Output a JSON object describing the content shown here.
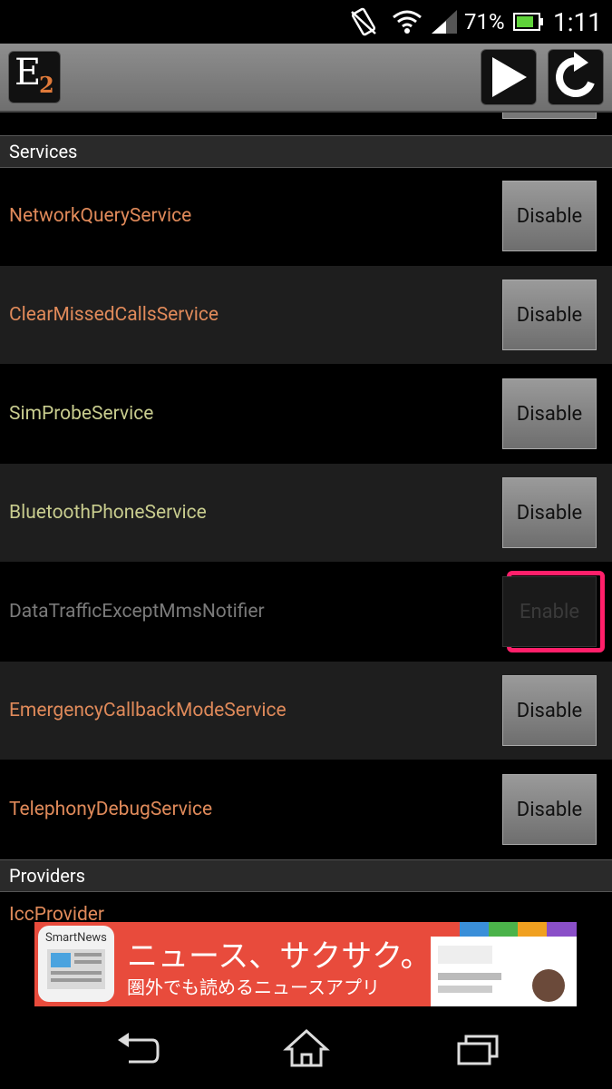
{
  "status_bar": {
    "battery_percent": "71%",
    "time": "1:11",
    "icons": [
      "vibrate-icon",
      "wifi-icon",
      "signal-icon",
      "battery-icon"
    ]
  },
  "action_bar": {
    "logo_letter": "E",
    "logo_sub": "2",
    "icons": [
      "play-icon",
      "refresh-icon"
    ]
  },
  "sections": {
    "services": "Services",
    "providers": "Providers"
  },
  "services": [
    {
      "name": "NetworkQueryService",
      "button": "Disable",
      "color": "#e08a5a"
    },
    {
      "name": "ClearMissedCallsService",
      "button": "Disable",
      "color": "#e08a5a"
    },
    {
      "name": "SimProbeService",
      "button": "Disable",
      "color": "#c8cc8e"
    },
    {
      "name": "BluetoothPhoneService",
      "button": "Disable",
      "color": "#c8cc8e"
    },
    {
      "name": "DataTrafficExceptMmsNotifier",
      "button": "Enable",
      "color": "#7a7a7a"
    },
    {
      "name": "EmergencyCallbackModeService",
      "button": "Disable",
      "color": "#e08a5a"
    },
    {
      "name": "TelephonyDebugService",
      "button": "Disable",
      "color": "#e08a5a"
    }
  ],
  "providers": [
    {
      "name": "IccProvider",
      "color": "#e08a5a"
    }
  ],
  "ad": {
    "app_name": "SmartNews",
    "title": "ニュース、サクサク。",
    "subtitle": "圏外でも読めるニュースアプリ"
  },
  "nav_bar": {
    "icons": [
      "back-icon",
      "home-icon",
      "recent-apps-icon"
    ]
  }
}
